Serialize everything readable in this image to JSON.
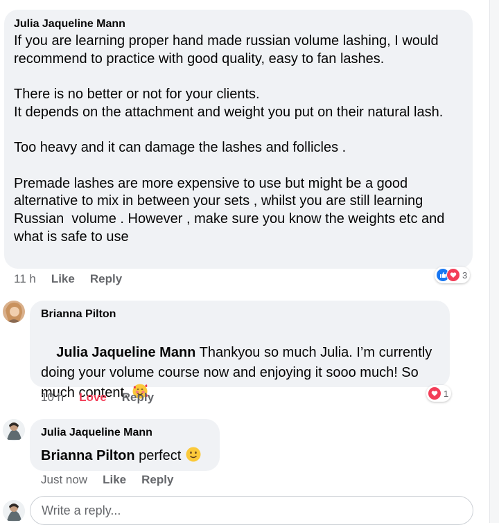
{
  "comment1": {
    "author": "Julia Jaqueline Mann",
    "text": "If you are learning proper hand made russian volume lashing, I would recommend to practice with good quality, easy to fan lashes.\n\nThere is no better or not for your clients.\nIt depends on the attachment and weight you put on their natural lash.\n\nToo heavy and it can damage the lashes and follicles .\n\nPremade lashes are more expensive to use but might be a good alternative to mix in between your sets , whilst you are still learning Russian  volume . However , make sure you know the weights etc and what is safe to use",
    "time": "11 h",
    "like_label": "Like",
    "reply_label": "Reply",
    "reaction_count": "3",
    "reaction_icons": [
      "like-icon",
      "heart-icon"
    ]
  },
  "comment2": {
    "author": "Brianna Pilton",
    "mention": "Julia Jaqueline Mann",
    "text": " Thankyou so much Julia. I’m currently doing your volume course now and enjoying it sooo much! So much content. ",
    "emoji": "smiling-face-with-hearts",
    "time": "10 h",
    "reaction_label": "Love",
    "reply_label": "Reply",
    "reaction_count": "1",
    "reaction_icons": [
      "heart-icon"
    ]
  },
  "comment3": {
    "author": "Julia Jaqueline Mann",
    "mention": "Brianna Pilton",
    "text": " perfect ",
    "emoji": "slightly-smiling-face",
    "time": "Just now",
    "like_label": "Like",
    "reply_label": "Reply"
  },
  "reply_box": {
    "placeholder": "Write a reply..."
  },
  "colors": {
    "bubble": "#f0f2f5",
    "meta_text": "#65676b",
    "love": "#f33e58",
    "like_blue": "#1877f2"
  }
}
